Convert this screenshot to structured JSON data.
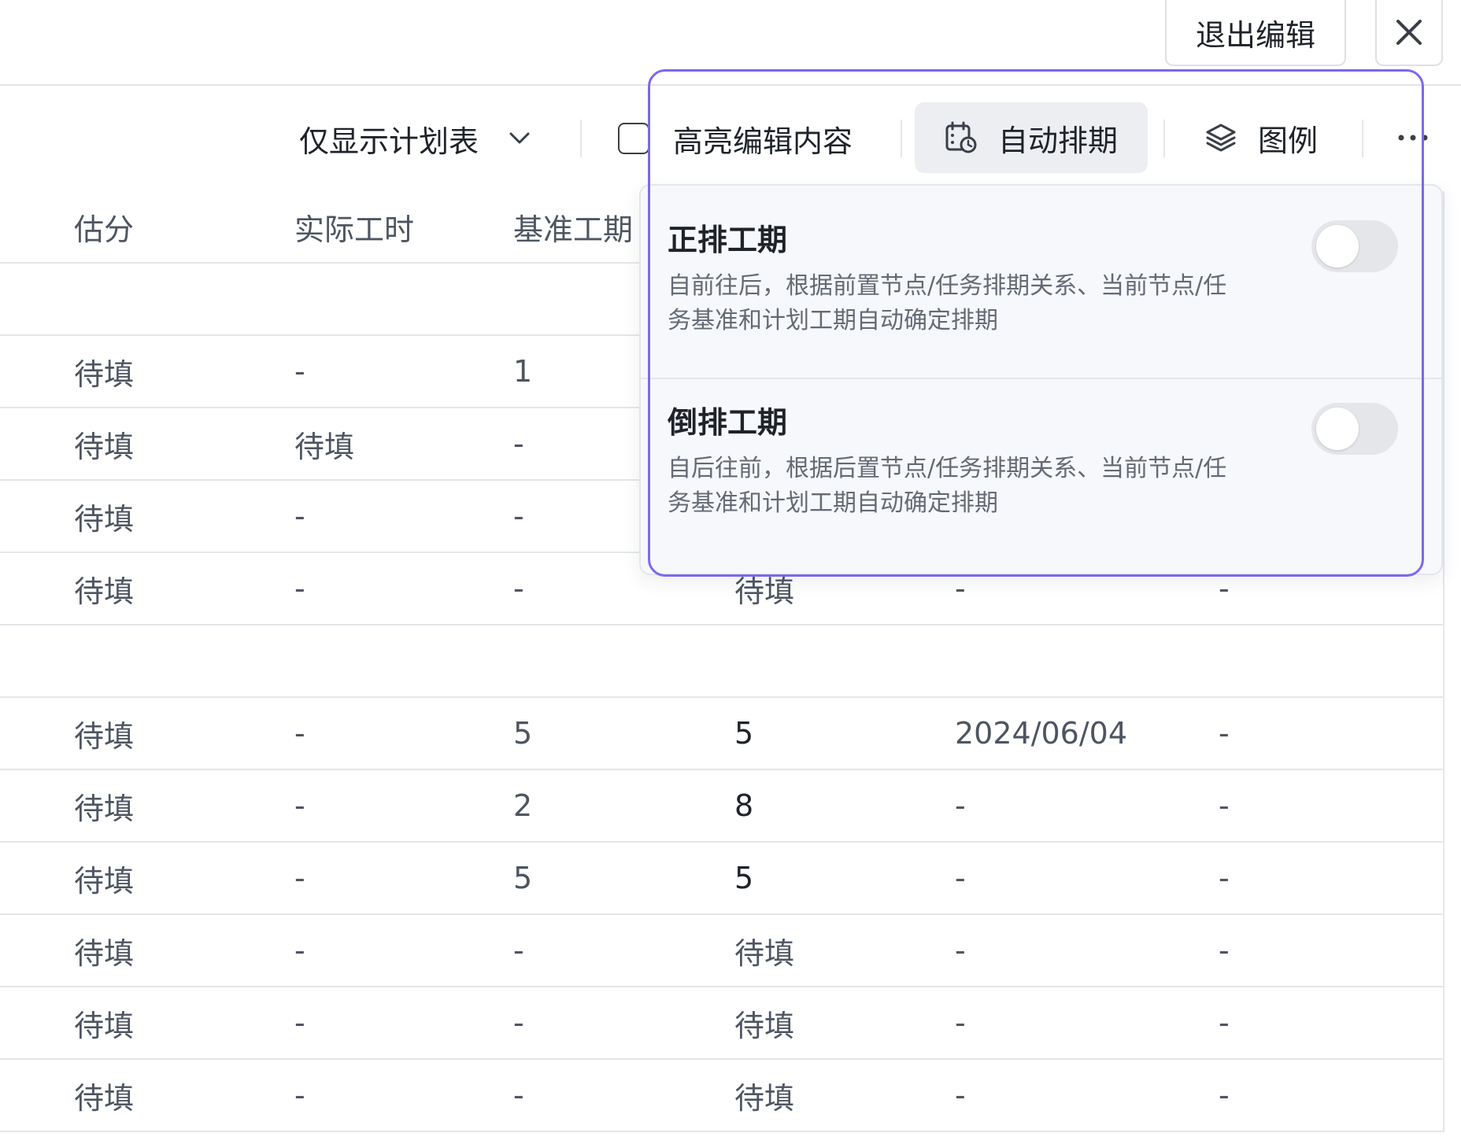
{
  "topbar": {
    "exit_label": "退出编辑",
    "close_icon": "close-icon"
  },
  "toolbar": {
    "view_select": "仅显示计划表",
    "highlight_label": "高亮编辑内容",
    "auto_schedule_label": "自动排期",
    "legend_label": "图例",
    "more_icon": "more-icon"
  },
  "table": {
    "headers": [
      "估分",
      "实际工时",
      "基准工期"
    ],
    "rows": [
      [
        "",
        "",
        "",
        "",
        "",
        ""
      ],
      [
        "待填",
        "-",
        "1",
        "",
        "",
        ""
      ],
      [
        "待填",
        "待填",
        "-",
        "",
        "",
        ""
      ],
      [
        "待填",
        "-",
        "-",
        "",
        "",
        ""
      ],
      [
        "待填",
        "-",
        "-",
        "待填",
        "-",
        "-"
      ],
      [
        "",
        "",
        "",
        "",
        "",
        ""
      ],
      [
        "待填",
        "-",
        "5",
        "5",
        "2024/06/04",
        "-"
      ],
      [
        "待填",
        "-",
        "2",
        "8",
        "-",
        "-"
      ],
      [
        "待填",
        "-",
        "5",
        "5",
        "-",
        "-"
      ],
      [
        "待填",
        "-",
        "-",
        "待填",
        "-",
        "-"
      ],
      [
        "待填",
        "-",
        "-",
        "待填",
        "-",
        "-"
      ],
      [
        "待填",
        "-",
        "-",
        "待填",
        "-",
        "-"
      ]
    ]
  },
  "popover": {
    "options": [
      {
        "title": "正排工期",
        "desc": "自前往后，根据前置节点/任务排期关系、当前节点/任务基准和计划工期自动确定排期",
        "enabled": false
      },
      {
        "title": "倒排工期",
        "desc": "自后往前，根据后置节点/任务排期关系、当前节点/任务基准和计划工期自动确定排期",
        "enabled": false
      }
    ]
  },
  "colors": {
    "highlight_border": "#7b68ee",
    "toggle_off": "#e5e6ea"
  }
}
